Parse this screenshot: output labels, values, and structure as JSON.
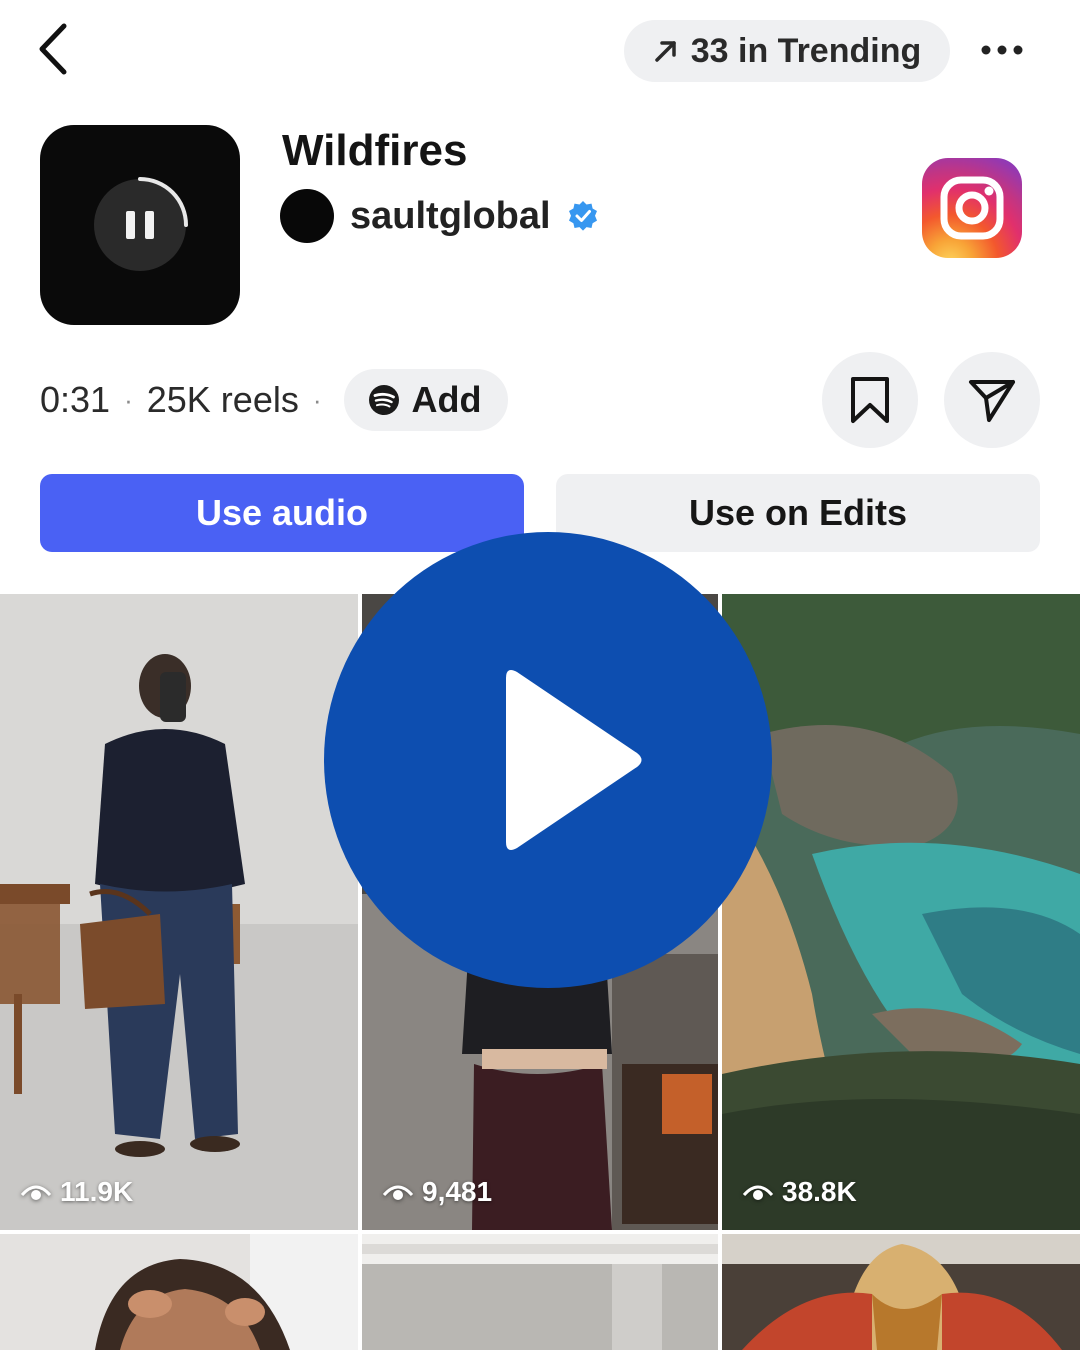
{
  "topbar": {
    "trending_label": "33 in Trending"
  },
  "header": {
    "title": "Wildfires",
    "artist": "saultglobal",
    "verified": true
  },
  "meta": {
    "duration": "0:31",
    "separator": "·",
    "reels_count": "25K reels",
    "add_label": "Add"
  },
  "actions": {
    "use_audio": "Use audio",
    "use_on_edits": "Use on Edits"
  },
  "grid": {
    "tiles": [
      {
        "views": "11.9K"
      },
      {
        "views": "9,481"
      },
      {
        "views": "38.8K"
      }
    ]
  },
  "colors": {
    "accent": "#4a61f4",
    "pill_bg": "#eff0f2",
    "verified_blue": "#3797f0",
    "overlay_play": "#0d4eb0"
  },
  "icons": {
    "back": "chevron-left-icon",
    "trending": "arrow-up-right-icon",
    "more": "more-horizontal-icon",
    "pause": "pause-icon",
    "verified": "verified-badge-icon",
    "instagram": "instagram-logo-icon",
    "spotify": "spotify-icon",
    "save": "bookmark-icon",
    "share": "send-icon",
    "views": "eye-icon",
    "play": "play-icon"
  }
}
